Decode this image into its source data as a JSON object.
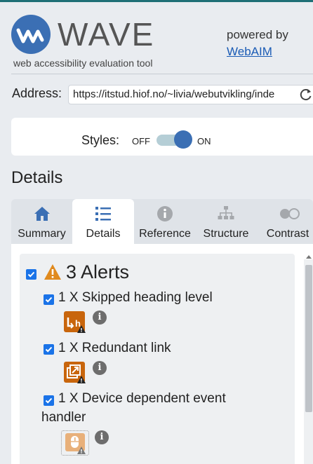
{
  "header": {
    "logo_text": "WAVE",
    "tagline": "web accessibility evaluation tool",
    "powered_by": "powered by",
    "webaim_link": "WebAIM"
  },
  "address": {
    "label": "Address:",
    "value": "https://itstud.hiof.no/~livia/webutvikling/inde"
  },
  "styles": {
    "label": "Styles:",
    "off": "OFF",
    "on": "ON",
    "state": "on"
  },
  "details_heading": "Details",
  "tabs": [
    {
      "label": "Summary",
      "icon": "home-icon"
    },
    {
      "label": "Details",
      "icon": "list-icon",
      "active": true
    },
    {
      "label": "Reference",
      "icon": "info-icon"
    },
    {
      "label": "Structure",
      "icon": "sitemap-icon"
    },
    {
      "label": "Contrast",
      "icon": "contrast-icon"
    }
  ],
  "alerts": {
    "title": "3 Alerts",
    "checked": true,
    "items": [
      {
        "label": "1 X Skipped heading level",
        "checked": true,
        "icon": "skipped-heading-icon",
        "info": "i"
      },
      {
        "label": "1 X Redundant link",
        "checked": true,
        "icon": "redundant-link-icon",
        "info": "i"
      },
      {
        "label_line1": "1 X Device dependent event",
        "label_line2": "handler",
        "checked": true,
        "icon": "device-dependent-event-icon",
        "info": "i"
      }
    ]
  },
  "colors": {
    "brand_blue": "#3b6fb4",
    "alert_orange": "#c8650c",
    "checkbox_blue": "#1a73e8",
    "link_blue": "#1a5bb5"
  }
}
